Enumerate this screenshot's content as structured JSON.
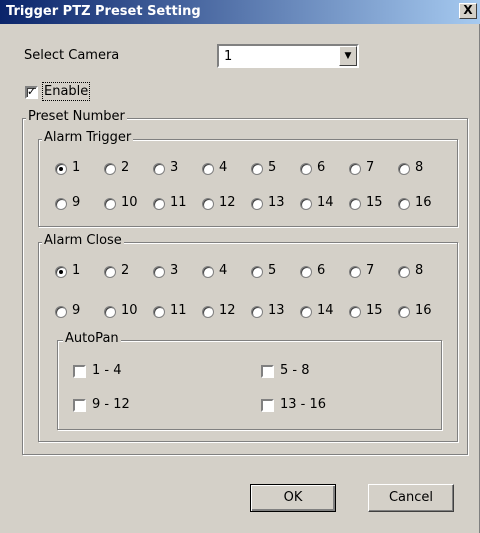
{
  "window": {
    "title": "Trigger PTZ Preset Setting",
    "close_glyph": "X"
  },
  "select_camera": {
    "label": "Select Camera",
    "value": "1"
  },
  "enable": {
    "label": "Enable",
    "checked": true
  },
  "preset_number": {
    "title": "Preset Number",
    "alarm_trigger": {
      "title": "Alarm Trigger",
      "options": [
        "1",
        "2",
        "3",
        "4",
        "5",
        "6",
        "7",
        "8",
        "9",
        "10",
        "11",
        "12",
        "13",
        "14",
        "15",
        "16"
      ],
      "selected": "1"
    },
    "alarm_close": {
      "title": "Alarm Close",
      "options": [
        "1",
        "2",
        "3",
        "4",
        "5",
        "6",
        "7",
        "8",
        "9",
        "10",
        "11",
        "12",
        "13",
        "14",
        "15",
        "16"
      ],
      "selected": "1"
    },
    "autopan": {
      "title": "AutoPan",
      "items": [
        {
          "label": "1 - 4",
          "checked": false
        },
        {
          "label": "5 - 8",
          "checked": false
        },
        {
          "label": "9 - 12",
          "checked": false
        },
        {
          "label": "13 - 16",
          "checked": false
        }
      ]
    }
  },
  "buttons": {
    "ok": "OK",
    "cancel": "Cancel"
  },
  "icons": {
    "combo_arrow": "chevron-down-icon",
    "check": "check-icon"
  }
}
